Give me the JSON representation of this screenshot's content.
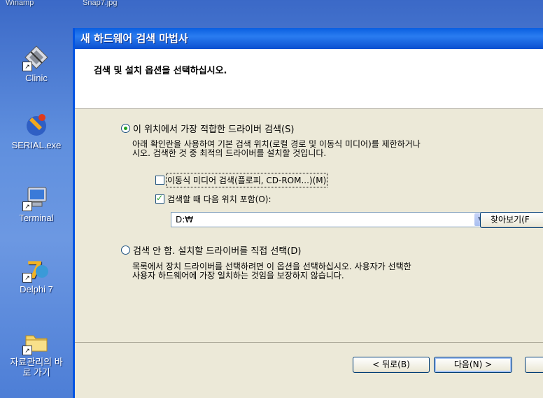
{
  "desktop": {
    "top_labels": [
      "Winamp",
      "Snap7.jpg"
    ],
    "icons": [
      {
        "label": "Clinic",
        "icon": "clinic-icon"
      },
      {
        "label": "SERIAL.exe",
        "icon": "serial-exe-icon"
      },
      {
        "label": "Terminal",
        "icon": "terminal-icon"
      },
      {
        "label": "Delphi 7",
        "icon": "delphi-icon"
      },
      {
        "label": "자료관리의 바로 가기",
        "icon": "folder-shortcut-icon"
      }
    ]
  },
  "wizard": {
    "title": "새 하드웨어 검색 마법사",
    "header_title": "검색 및 설치 옵션을 선택하십시오.",
    "option1": {
      "label": "이 위치에서 가장 적합한 드라이버 검색(S)",
      "selected": true,
      "desc_line1": "아래 확인란을 사용하여 기본 검색 위치(로컬 경로 및 이동식 미디어)를 제한하거나",
      "desc_line2": "시오. 검색한 것 중 최적의 드라이버를 설치할 것입니다."
    },
    "check_removable": {
      "label": "이동식 미디어 검색(플로피, CD-ROM...)(M)",
      "checked": false
    },
    "check_include": {
      "label": "검색할 때 다음 위치 포함(O):",
      "checked": true
    },
    "path_value": "D:₩",
    "browse_label": "찾아보기(F",
    "option2": {
      "label": "검색 안 함. 설치할 드라이버를 직접 선택(D)",
      "selected": false,
      "desc_line1": "목록에서 장치 드라이버를 선택하려면 이 옵션을 선택하십시오. 사용자가 선택한",
      "desc_line2": "사용자 하드웨어에 가장 일치하는 것임을 보장하지 않습니다."
    },
    "buttons": {
      "back": "< 뒤로(B)",
      "next": "다음(N) >",
      "cancel": ""
    }
  },
  "colors": {
    "titlebar": "#0a5fe0",
    "dialog_bg": "#ece9d8",
    "accent_check": "#21a121"
  }
}
